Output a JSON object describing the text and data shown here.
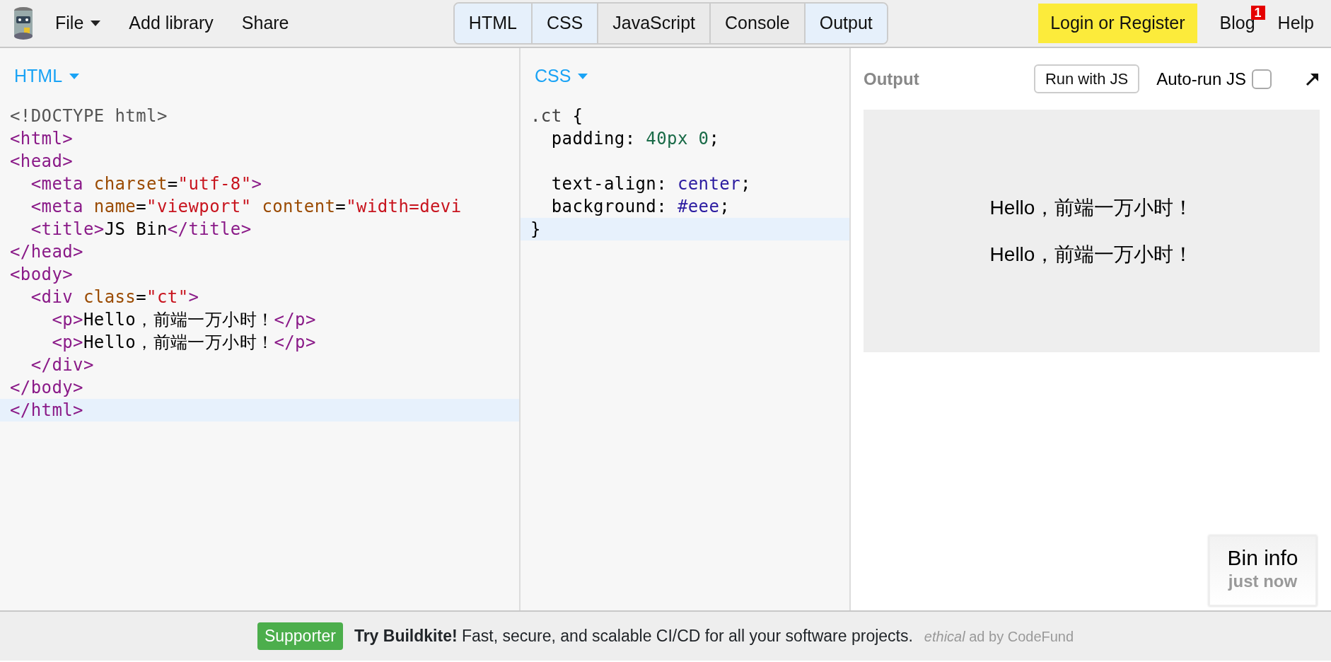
{
  "toolbar": {
    "menu": [
      {
        "label": "File",
        "dropdown": true
      },
      {
        "label": "Add library",
        "dropdown": false
      },
      {
        "label": "Share",
        "dropdown": false
      }
    ],
    "panel_tabs": [
      {
        "label": "HTML",
        "selected": true
      },
      {
        "label": "CSS",
        "selected": true
      },
      {
        "label": "JavaScript",
        "selected": false
      },
      {
        "label": "Console",
        "selected": false
      },
      {
        "label": "Output",
        "selected": true
      }
    ],
    "login": "Login or Register",
    "blog": {
      "label": "Blog",
      "badge": "1"
    },
    "help": "Help"
  },
  "panels": [
    {
      "label": "HTML",
      "lines": [
        {
          "active": false,
          "tokens": [
            {
              "text": "<!DOCTYPE html>",
              "kind": "doctype"
            }
          ]
        },
        {
          "active": false,
          "tokens": [
            {
              "text": "<html>",
              "kind": "tag"
            }
          ]
        },
        {
          "active": false,
          "tokens": [
            {
              "text": "<head>",
              "kind": "tag"
            }
          ]
        },
        {
          "active": false,
          "tokens": [
            {
              "text": "  <meta",
              "kind": "tag"
            },
            {
              "text": " charset",
              "kind": "attr"
            },
            {
              "text": "=",
              "kind": "plain"
            },
            {
              "text": "\"utf-8\"",
              "kind": "string"
            },
            {
              "text": ">",
              "kind": "tag"
            }
          ]
        },
        {
          "active": false,
          "tokens": [
            {
              "text": "  <meta",
              "kind": "tag"
            },
            {
              "text": " name",
              "kind": "attr"
            },
            {
              "text": "=",
              "kind": "plain"
            },
            {
              "text": "\"viewport\"",
              "kind": "string"
            },
            {
              "text": " content",
              "kind": "attr"
            },
            {
              "text": "=",
              "kind": "plain"
            },
            {
              "text": "\"width=devi",
              "kind": "string"
            }
          ]
        },
        {
          "active": false,
          "tokens": [
            {
              "text": "  <title>",
              "kind": "tag"
            },
            {
              "text": "JS Bin",
              "kind": "plain"
            },
            {
              "text": "</title>",
              "kind": "tag"
            }
          ]
        },
        {
          "active": false,
          "tokens": [
            {
              "text": "</head>",
              "kind": "tag"
            }
          ]
        },
        {
          "active": false,
          "tokens": [
            {
              "text": "<body>",
              "kind": "tag"
            }
          ]
        },
        {
          "active": false,
          "tokens": [
            {
              "text": "  <div",
              "kind": "tag"
            },
            {
              "text": " class",
              "kind": "attr"
            },
            {
              "text": "=",
              "kind": "plain"
            },
            {
              "text": "\"ct\"",
              "kind": "string"
            },
            {
              "text": ">",
              "kind": "tag"
            }
          ]
        },
        {
          "active": false,
          "tokens": [
            {
              "text": "    <p>",
              "kind": "tag"
            },
            {
              "text": "Hello，前端一万小时！",
              "kind": "plain"
            },
            {
              "text": "</p>",
              "kind": "tag"
            }
          ]
        },
        {
          "active": false,
          "tokens": [
            {
              "text": "    <p>",
              "kind": "tag"
            },
            {
              "text": "Hello，前端一万小时！",
              "kind": "plain"
            },
            {
              "text": "</p>",
              "kind": "tag"
            }
          ]
        },
        {
          "active": false,
          "tokens": [
            {
              "text": "  </div>",
              "kind": "tag"
            }
          ]
        },
        {
          "active": false,
          "tokens": [
            {
              "text": "</body>",
              "kind": "tag"
            }
          ]
        },
        {
          "active": true,
          "tokens": [
            {
              "text": "</html>",
              "kind": "tag"
            }
          ]
        }
      ]
    },
    {
      "label": "CSS",
      "lines": [
        {
          "active": false,
          "tokens": [
            {
              "text": ".ct",
              "kind": "selector"
            },
            {
              "text": " {",
              "kind": "plain"
            }
          ]
        },
        {
          "active": false,
          "tokens": [
            {
              "text": "  padding: ",
              "kind": "plain"
            },
            {
              "text": "40px 0",
              "kind": "number"
            },
            {
              "text": ";",
              "kind": "plain"
            }
          ]
        },
        {
          "active": false
        },
        {
          "active": false,
          "tokens": [
            {
              "text": "  text-align: ",
              "kind": "plain"
            },
            {
              "text": "center",
              "kind": "keyword"
            },
            {
              "text": ";",
              "kind": "plain"
            }
          ]
        },
        {
          "active": false,
          "tokens": [
            {
              "text": "  background: ",
              "kind": "plain"
            },
            {
              "text": "#eee",
              "kind": "keyword"
            },
            {
              "text": ";",
              "kind": "plain"
            }
          ]
        },
        {
          "active": true,
          "tokens": [
            {
              "text": "}",
              "kind": "plain"
            }
          ]
        }
      ]
    }
  ],
  "output": {
    "title": "Output",
    "run_button": "Run with JS",
    "autorun": {
      "label": "Auto-run JS",
      "checked": false
    },
    "paragraphs": [
      "Hello，前端一万小时！",
      "Hello，前端一万小时！"
    ],
    "bin_info": {
      "title": "Bin info",
      "time": "just now"
    }
  },
  "ad": {
    "badge": "Supporter",
    "text": "**Try Buildkite!** Fast, secure, and scalable CI/CD for all your software projects.",
    "via": "*ethical* ad by CodeFund"
  }
}
